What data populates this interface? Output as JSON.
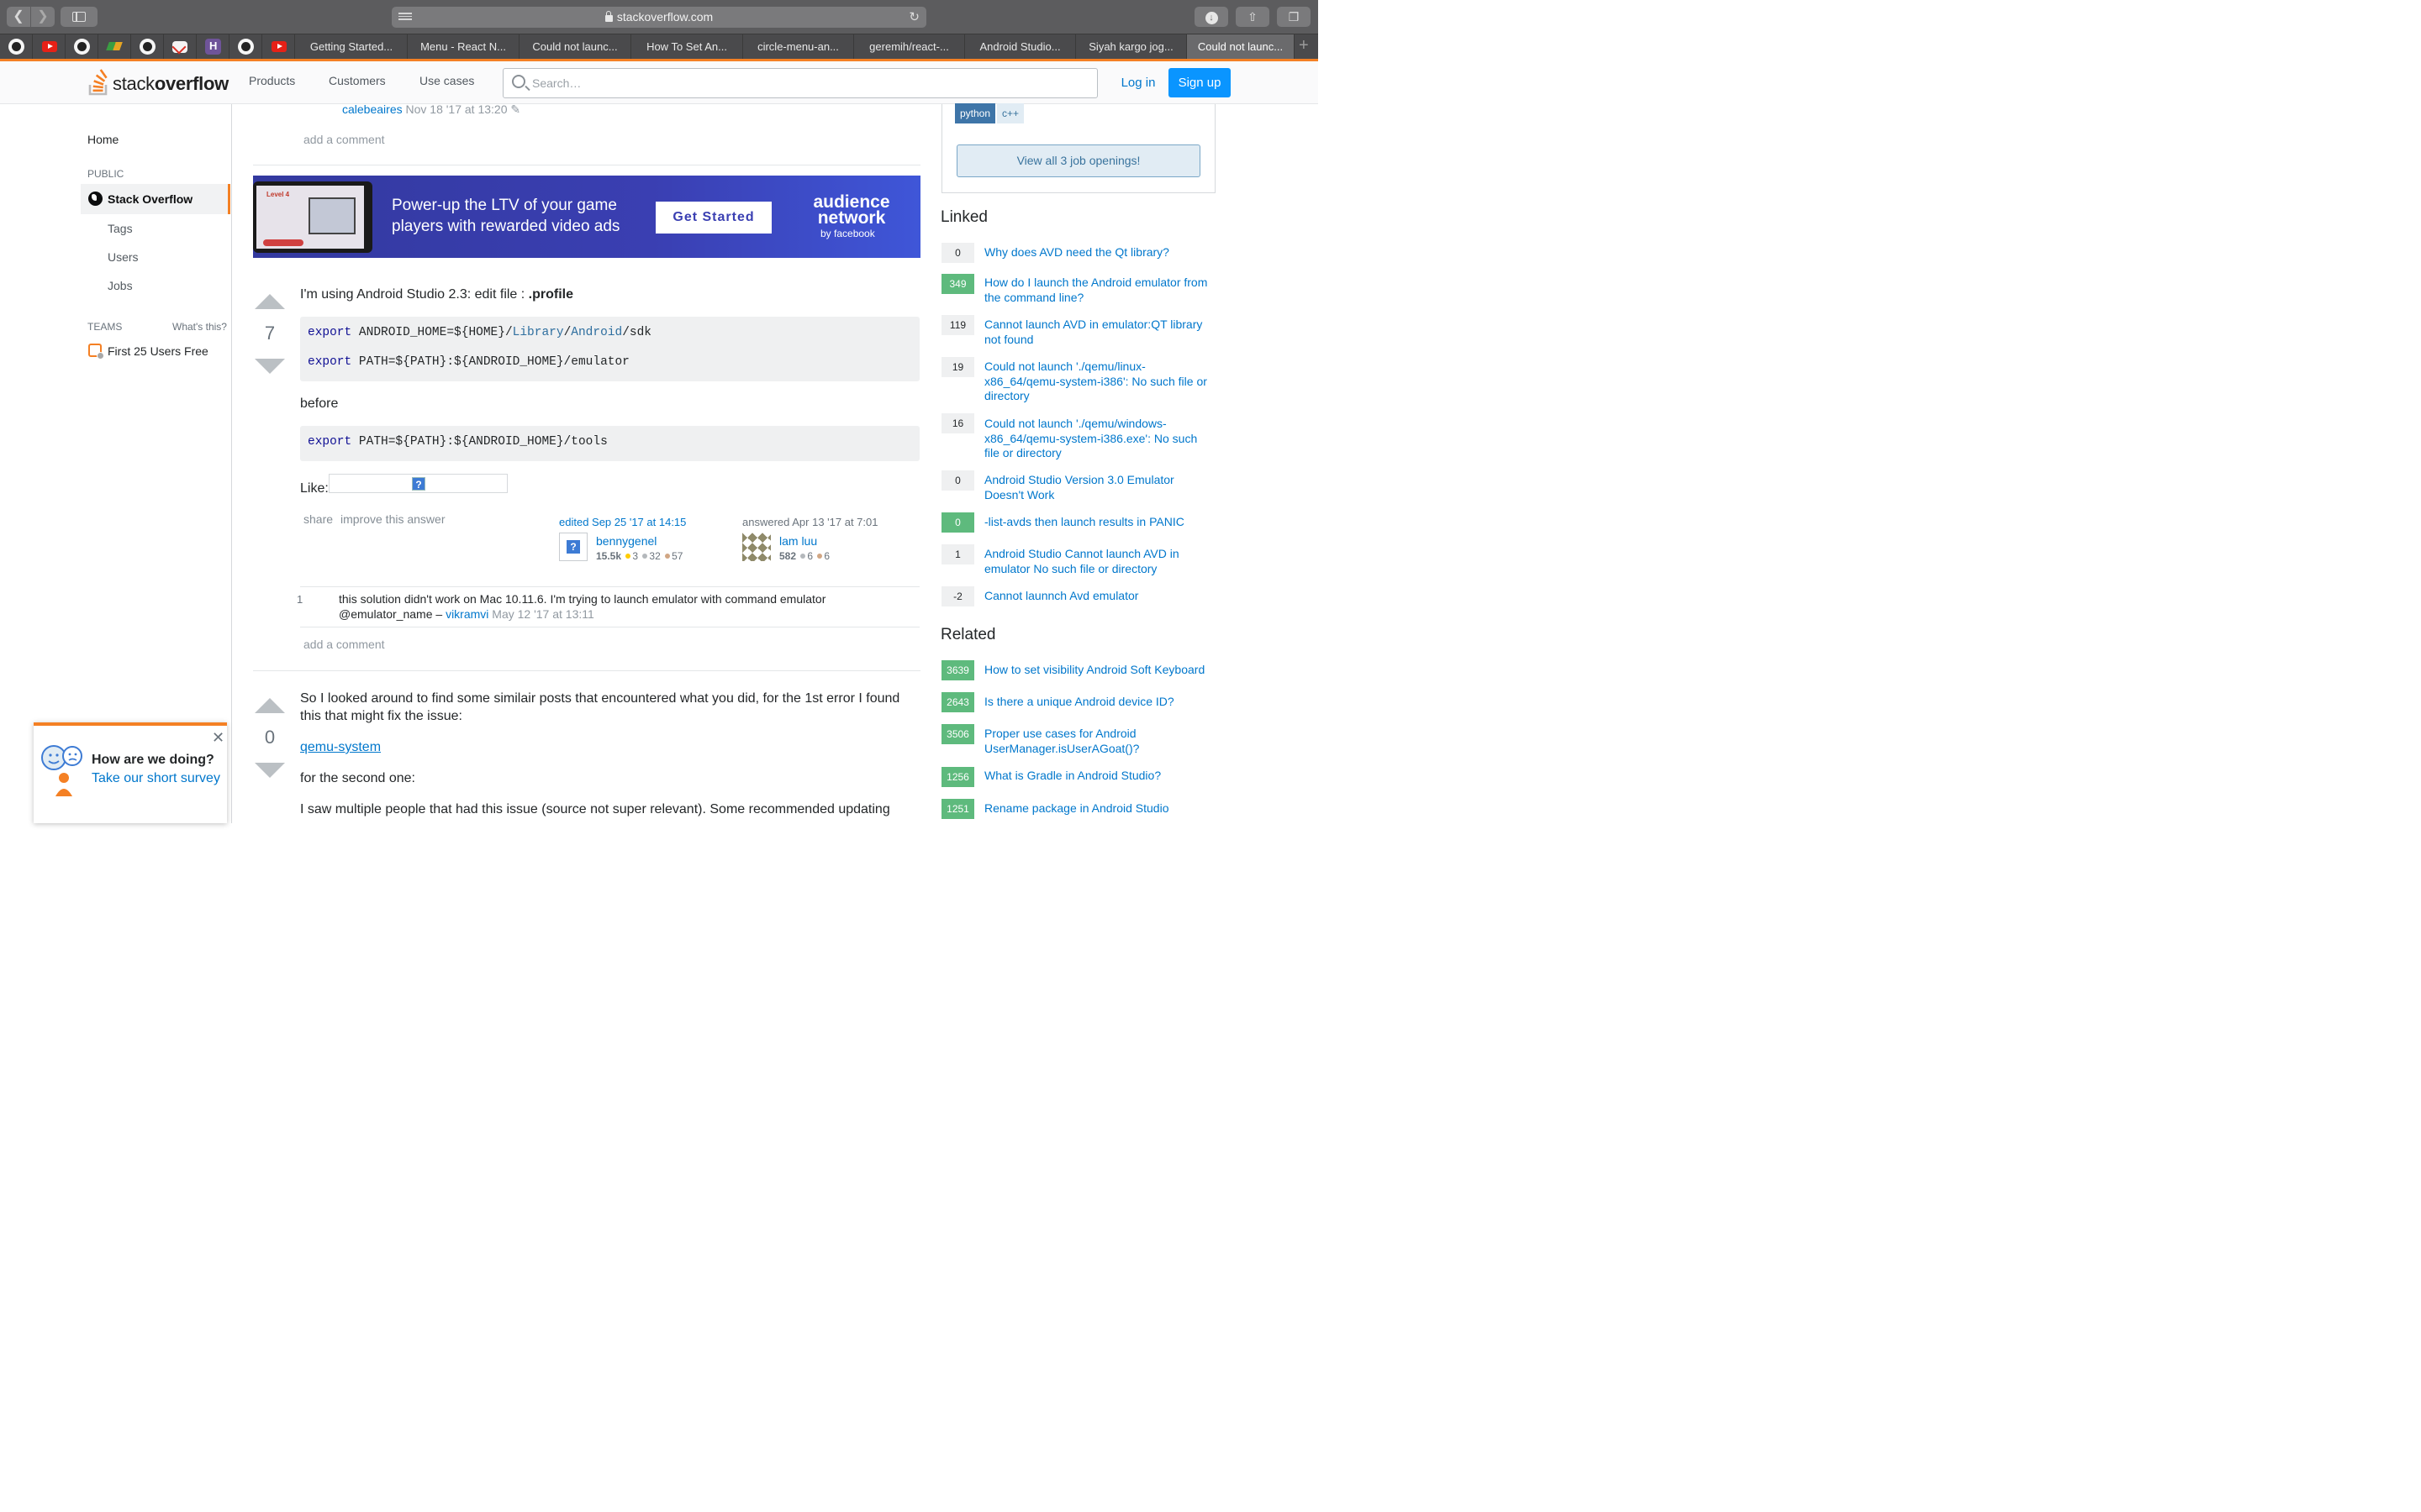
{
  "browser": {
    "url": "stackoverflow.com",
    "pinned_tabs": [
      {
        "icon": "github-icon"
      },
      {
        "icon": "youtube-icon"
      },
      {
        "icon": "github-icon"
      },
      {
        "icon": "multicolor-app-icon"
      },
      {
        "icon": "github-icon"
      },
      {
        "icon": "gmail-icon"
      },
      {
        "icon": "heroku-icon"
      },
      {
        "icon": "github-icon"
      },
      {
        "icon": "youtube-icon"
      }
    ],
    "tabs": [
      {
        "label": "Getting Started..."
      },
      {
        "label": "Menu - React N..."
      },
      {
        "label": "Could not launc..."
      },
      {
        "label": "How To Set An..."
      },
      {
        "label": "circle-menu-an..."
      },
      {
        "label": "geremih/react-..."
      },
      {
        "label": "Android Studio..."
      },
      {
        "label": "Siyah kargo jog..."
      },
      {
        "label": "Could not launc..."
      }
    ]
  },
  "header": {
    "logo_light": "stack",
    "logo_bold": "overflow",
    "nav": [
      "Products",
      "Customers",
      "Use cases"
    ],
    "search_placeholder": "Search…",
    "login": "Log in",
    "signup": "Sign up",
    "accent_color": "#f48024"
  },
  "sidebar": {
    "home": "Home",
    "public_label": "PUBLIC",
    "stack_overflow": "Stack Overflow",
    "tags": "Tags",
    "users": "Users",
    "jobs": "Jobs",
    "teams_label": "TEAMS",
    "whats_this": "What's this?",
    "teams_item": "First 25 Users Free"
  },
  "prev_comment": {
    "user": "calebeaires",
    "date": "Nov 18 '17 at 13:20",
    "add_comment": "add a comment"
  },
  "ad": {
    "level": "Level 4",
    "headline": "Power-up the LTV of your game players with rewarded video ads",
    "cta": "Get Started",
    "brand": "audience network",
    "brand_sub": "by facebook"
  },
  "answer1": {
    "votes": "7",
    "intro": "I'm using Android Studio 2.3: edit file : ",
    "intro_bold": ".profile",
    "code1": {
      "line1": {
        "kw": "export",
        "a": " ANDROID_HOME=${HOME}/",
        "b": "Library",
        "c": "/",
        "d": "Android",
        "e": "/sdk"
      },
      "line2": {
        "kw": "export",
        "a": " PATH=${PATH}:${ANDROID_HOME}/emulator"
      }
    },
    "before": "before",
    "code2": {
      "kw": "export",
      "a": " PATH=${PATH}:${ANDROID_HOME}/tools"
    },
    "like": "Like:",
    "share": "share",
    "improve": "improve this answer",
    "edited": "edited Sep 25 '17 at 14:15",
    "editor": {
      "name": "bennygenel",
      "rep": "15.5k",
      "gold": "3",
      "silver": "32",
      "bronze": "57"
    },
    "answered": "answered Apr 13 '17 at 7:01",
    "author": {
      "name": "lam luu",
      "rep": "582",
      "silver": "6",
      "bronze": "6"
    },
    "comment": {
      "score": "1",
      "text": "this solution didn't work on Mac 10.11.6. I'm trying to launch emulator with command emulator @emulator_name – ",
      "user": "vikramvi",
      "date": "May 12 '17 at 13:11"
    },
    "add_comment": "add a comment"
  },
  "answer2": {
    "votes": "0",
    "p1": "So I looked around to find some similair posts that encountered what you did, for the 1st error I found this that might fix the issue:",
    "link": "qemu-system",
    "p2": "for the second one:",
    "p3": "I saw multiple people that had this issue (source not super relevant). Some recommended updating"
  },
  "jobs": {
    "tags": [
      "python",
      "c++"
    ],
    "view_all": "View all 3 job openings!"
  },
  "linked": {
    "title": "Linked",
    "items": [
      {
        "score": "0",
        "answered": false,
        "title": "Why does AVD need the Qt library?"
      },
      {
        "score": "349",
        "answered": true,
        "title": "How do I launch the Android emulator from the command line?"
      },
      {
        "score": "119",
        "answered": false,
        "title": "Cannot launch AVD in emulator:QT library not found"
      },
      {
        "score": "19",
        "answered": false,
        "title": "Could not launch './qemu/linux-x86_64/qemu-system-i386': No such file or directory"
      },
      {
        "score": "16",
        "answered": false,
        "title": "Could not launch './qemu/windows-x86_64/qemu-system-i386.exe': No such file or directory"
      },
      {
        "score": "0",
        "answered": false,
        "title": "Android Studio Version 3.0 Emulator Doesn't Work"
      },
      {
        "score": "0",
        "answered": true,
        "title": "-list-avds then launch results in PANIC"
      },
      {
        "score": "1",
        "answered": false,
        "title": "Android Studio Cannot launch AVD in emulator No such file or directory"
      },
      {
        "score": "-2",
        "answered": false,
        "title": "Cannot launnch Avd emulator"
      }
    ]
  },
  "related": {
    "title": "Related",
    "items": [
      {
        "score": "3639",
        "answered": true,
        "title": "How to set visibility Android Soft Keyboard"
      },
      {
        "score": "2643",
        "answered": true,
        "title": "Is there a unique Android device ID?"
      },
      {
        "score": "3506",
        "answered": true,
        "title": "Proper use cases for Android UserManager.isUserAGoat()?"
      },
      {
        "score": "1256",
        "answered": true,
        "title": "What is Gradle in Android Studio?"
      },
      {
        "score": "1251",
        "answered": true,
        "title": "Rename package in Android Studio"
      }
    ]
  },
  "survey": {
    "title": "How are we doing?",
    "link": "Take our short survey",
    "close": "✕"
  }
}
